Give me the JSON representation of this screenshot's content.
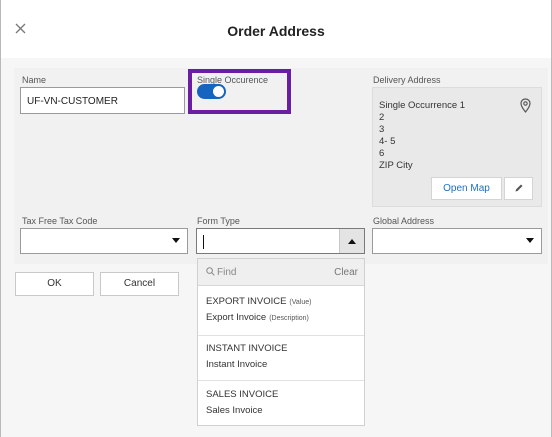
{
  "dialog": {
    "title": "Order Address",
    "close_icon": "close-icon"
  },
  "fields": {
    "name": {
      "label": "Name",
      "value": "UF-VN-CUSTOMER"
    },
    "single_occurence": {
      "label": "Single Occurence",
      "enabled": true
    },
    "delivery_address": {
      "label": "Delivery Address",
      "lines": [
        "Single Occurrence 1",
        "2",
        "3",
        "4- 5",
        "6",
        "ZIP City"
      ],
      "open_map_label": "Open Map",
      "pin_icon": "location-pin-icon",
      "edit_icon": "pencil-icon"
    },
    "tax_free_tax_code": {
      "label": "Tax Free Tax Code",
      "value": ""
    },
    "form_type": {
      "label": "Form Type",
      "value": ""
    },
    "global_address": {
      "label": "Global Address",
      "value": ""
    }
  },
  "buttons": {
    "ok": "OK",
    "cancel": "Cancel"
  },
  "dropdown": {
    "find_placeholder": "Find",
    "clear_label": "Clear",
    "options": [
      {
        "value": "EXPORT INVOICE",
        "value_tag": "(Value)",
        "description": "Export Invoice",
        "description_tag": "(Description)"
      },
      {
        "value": "INSTANT INVOICE",
        "description": "Instant Invoice"
      },
      {
        "value": "SALES INVOICE",
        "description": "Sales Invoice"
      }
    ]
  },
  "colors": {
    "toggle_on": "#1565c0",
    "highlight": "#6a1fa3",
    "link": "#1f6fc4"
  }
}
